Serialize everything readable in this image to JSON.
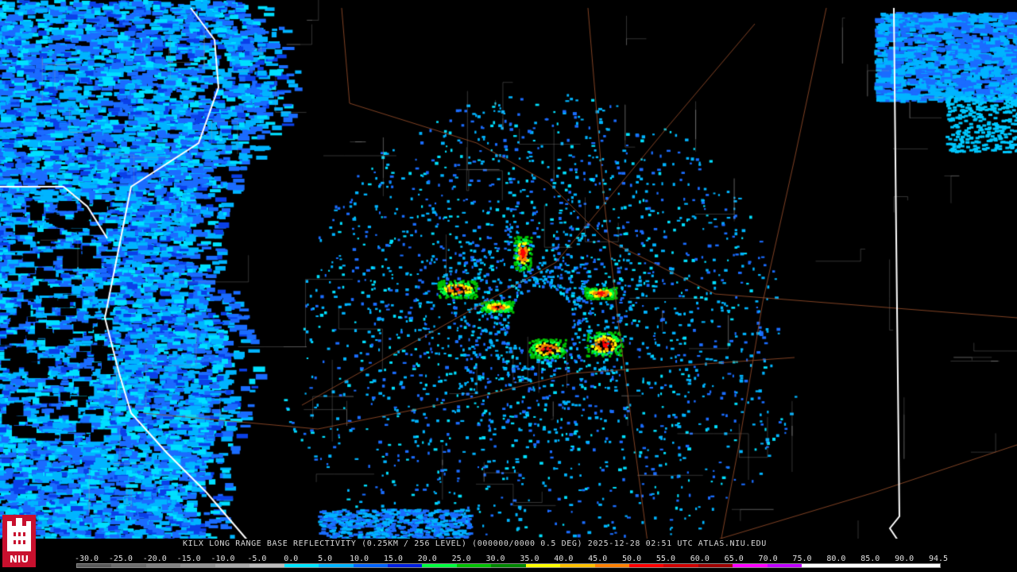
{
  "title": "KILX LONG RANGE BASE REFLECTIVITY (0.25KM / 256 LEVEL) (000000/0000 0.5 DEG) 2025-12-28 02:51 UTC  ATLAS.NIU.EDU",
  "logo_text": "NIU",
  "scale": {
    "labels": [
      "-30.0",
      "-25.0",
      "-20.0",
      "-15.0",
      "-10.0",
      "-5.0",
      "0.0",
      "5.0",
      "10.0",
      "15.0",
      "20.0",
      "25.0",
      "30.0",
      "35.0",
      "40.0",
      "45.0",
      "50.0",
      "55.0",
      "60.0",
      "65.0",
      "70.0",
      "75.0",
      "80.0",
      "85.0",
      "90.0",
      "94.5"
    ],
    "colors": [
      "#5a5a5a",
      "#6e6e6e",
      "#828282",
      "#969696",
      "#aaaaaa",
      "#bebebe",
      "#00e5ff",
      "#00b4ff",
      "#0064ff",
      "#0020e0",
      "#00ff40",
      "#00c000",
      "#008800",
      "#ffff00",
      "#ffc000",
      "#ff8000",
      "#ff0000",
      "#d00000",
      "#a00000",
      "#ff00ff",
      "#c000ff",
      "#ffffff",
      "#ffffff",
      "#ffffff",
      "#ffffff"
    ]
  },
  "colors": {
    "background": "#000000",
    "county_lines": "#a0a0a0",
    "roads": "#a0522d",
    "state_lines": "#ffffff"
  }
}
